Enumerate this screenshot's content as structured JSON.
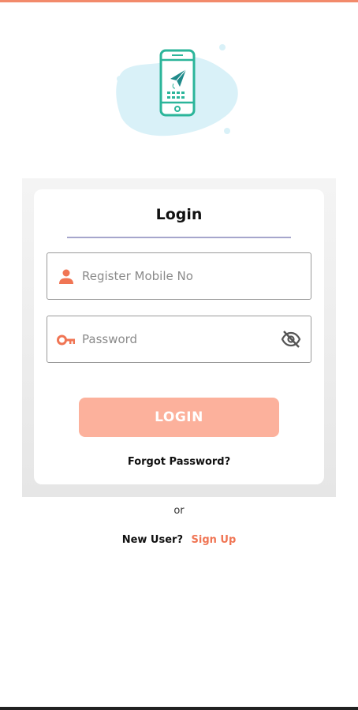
{
  "colors": {
    "accent": "#f07554",
    "top_bar": "#f28a6b",
    "button_bg": "#fcb19c",
    "illustration_teal": "#2bb59a",
    "illustration_splash": "#d9f1f8",
    "underline": "#a6a6cc"
  },
  "login": {
    "title": "Login",
    "mobile_placeholder": "Register Mobile No",
    "password_placeholder": "Password",
    "button_label": "LOGIN",
    "forgot_password": "Forgot Password?"
  },
  "footer": {
    "or_text": "or",
    "new_user_label": "New User?",
    "signup_label": "Sign Up"
  },
  "icons": {
    "mobile_field": "person-icon",
    "password_field": "key-icon",
    "visibility": "eye-off-icon",
    "illustration": "phone-paper-plane-illustration"
  }
}
